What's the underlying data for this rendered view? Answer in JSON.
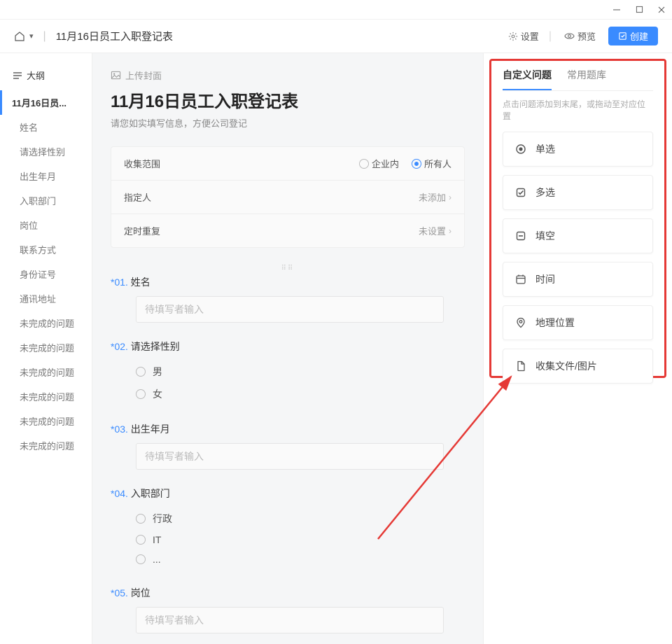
{
  "window": {
    "title": "11月16日员工入职登记表"
  },
  "header": {
    "settings": "设置",
    "preview": "预览",
    "create": "创建"
  },
  "outline": {
    "heading": "大纲",
    "active": "11月16日员...",
    "items": [
      "姓名",
      "请选择性别",
      "出生年月",
      "入职部门",
      "岗位",
      "联系方式",
      "身份证号",
      "通讯地址",
      "未完成的问题",
      "未完成的问题",
      "未完成的问题",
      "未完成的问题",
      "未完成的问题",
      "未完成的问题"
    ]
  },
  "form": {
    "upload_cover": "上传封面",
    "title": "11月16日员工入职登记表",
    "subtitle": "请您如实填写信息，方便公司登记",
    "settings": {
      "scope_label": "收集范围",
      "scope_opts": [
        "企业内",
        "所有人"
      ],
      "assignee_label": "指定人",
      "assignee_value": "未添加",
      "repeat_label": "定时重复",
      "repeat_value": "未设置"
    },
    "placeholder": "待填写者输入",
    "questions": [
      {
        "num": "01",
        "title": "姓名",
        "type": "text"
      },
      {
        "num": "02",
        "title": "请选择性别",
        "type": "radio",
        "opts": [
          "男",
          "女"
        ]
      },
      {
        "num": "03",
        "title": "出生年月",
        "type": "text"
      },
      {
        "num": "04",
        "title": "入职部门",
        "type": "radio",
        "opts": [
          "行政",
          "IT",
          "..."
        ]
      },
      {
        "num": "05",
        "title": "岗位",
        "type": "text"
      }
    ]
  },
  "right": {
    "tabs": [
      "自定义问题",
      "常用题库"
    ],
    "hint": "点击问题添加到末尾，或拖动至对应位置",
    "types": [
      "单选",
      "多选",
      "填空",
      "时间",
      "地理位置",
      "收集文件/图片"
    ]
  }
}
